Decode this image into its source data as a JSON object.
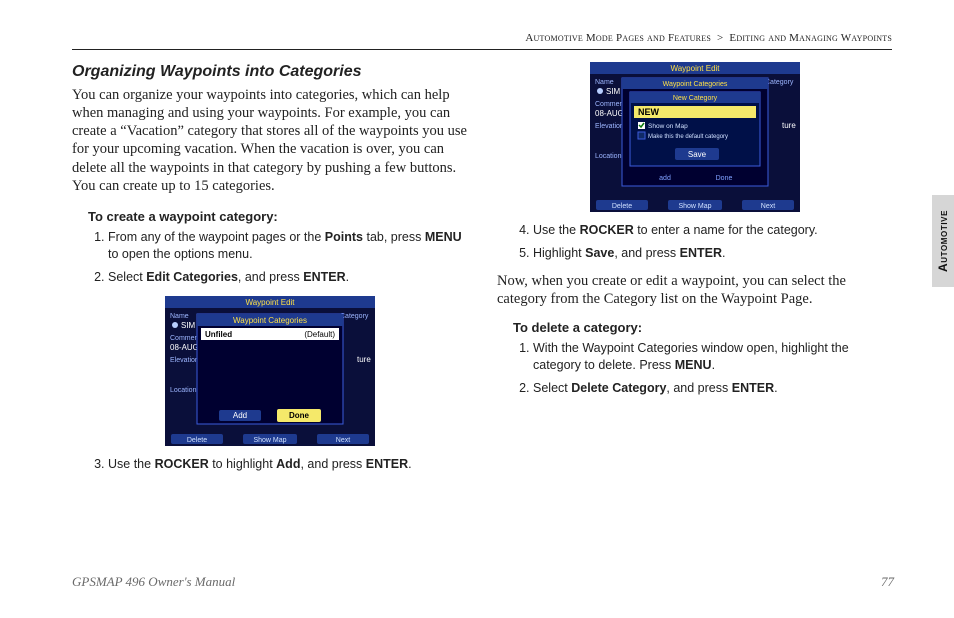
{
  "breadcrumb": {
    "a": "Automotive Mode Pages and Features",
    "sep": ">",
    "b": "Editing and Managing Waypoints"
  },
  "sideTab": "Automotive",
  "footer": {
    "left": "GPSMAP 496 Owner's Manual",
    "right": "77"
  },
  "section": {
    "title": "Organizing Waypoints into Categories",
    "intro": "You can organize your waypoints into categories, which can help when managing and using your waypoints. For example, you can create a “Vacation” category that stores all of the waypoints you use for your upcoming vacation. When the vacation is over, you can delete all the waypoints in that category by pushing a few buttons. You can create up to 15 categories."
  },
  "create": {
    "heading": "To create a waypoint category:",
    "step1_a": "From any of the waypoint pages or the ",
    "step1_b": "Points",
    "step1_c": " tab, press ",
    "step1_d": "MENU",
    "step1_e": " to open the options menu.",
    "step2_a": "Select ",
    "step2_b": "Edit Categories",
    "step2_c": ", and press ",
    "step2_d": "ENTER",
    "step2_e": ".",
    "step3_a": "Use the ",
    "step3_b": "ROCKER",
    "step3_c": " to highlight ",
    "step3_d": "Add",
    "step3_e": ", and press ",
    "step3_f": "ENTER",
    "step3_g": "."
  },
  "cont": {
    "step4_a": "Use the ",
    "step4_b": "ROCKER",
    "step4_c": " to enter a name for the category.",
    "step5_a": "Highlight ",
    "step5_b": "Save",
    "step5_c": ", and press ",
    "step5_d": "ENTER",
    "step5_e": ".",
    "after": "Now, when you create or edit a waypoint, you can select the category from the Category list on the Waypoint Page."
  },
  "delete": {
    "heading": "To delete a category:",
    "step1_a": "With the Waypoint Categories window open, highlight the category to delete. Press ",
    "step1_b": "MENU",
    "step1_c": ".",
    "step2_a": "Select ",
    "step2_b": "Delete Category",
    "step2_c": ", and press ",
    "step2_d": "ENTER",
    "step2_e": "."
  },
  "shot1": {
    "title": "Waypoint Edit",
    "sub": "Waypoint Categories",
    "row1": "Unfiled",
    "row1r": "(Default)",
    "btnAdd": "Add",
    "btnDone": "Done",
    "left": {
      "name": "Name",
      "sim": "SIM",
      "comment": "Comment",
      "db": "08-AUG",
      "elev": "Elevation",
      "loc": "Location"
    },
    "right": {
      "cat": "Category",
      "ture": "ture"
    },
    "soft": {
      "l": "Delete",
      "c": "Show Map",
      "r": "Next"
    }
  },
  "shot2": {
    "title": "Waypoint Edit",
    "sub": "Waypoint Categories",
    "newcat": "New Category",
    "input": "NEW",
    "chk1": "Show on Map",
    "chk2": "Make this the default category",
    "save": "Save",
    "left": {
      "name": "Name",
      "sim": "SIM",
      "comment": "Comment",
      "db": "08-AUG",
      "elev": "Elevation",
      "loc": "Location"
    },
    "right": {
      "cat": "Category",
      "ture": "ture"
    },
    "soft": {
      "l": "Delete",
      "c": "Show Map",
      "r": "Next"
    },
    "sub2": {
      "l": "add",
      "r": "Done"
    }
  }
}
